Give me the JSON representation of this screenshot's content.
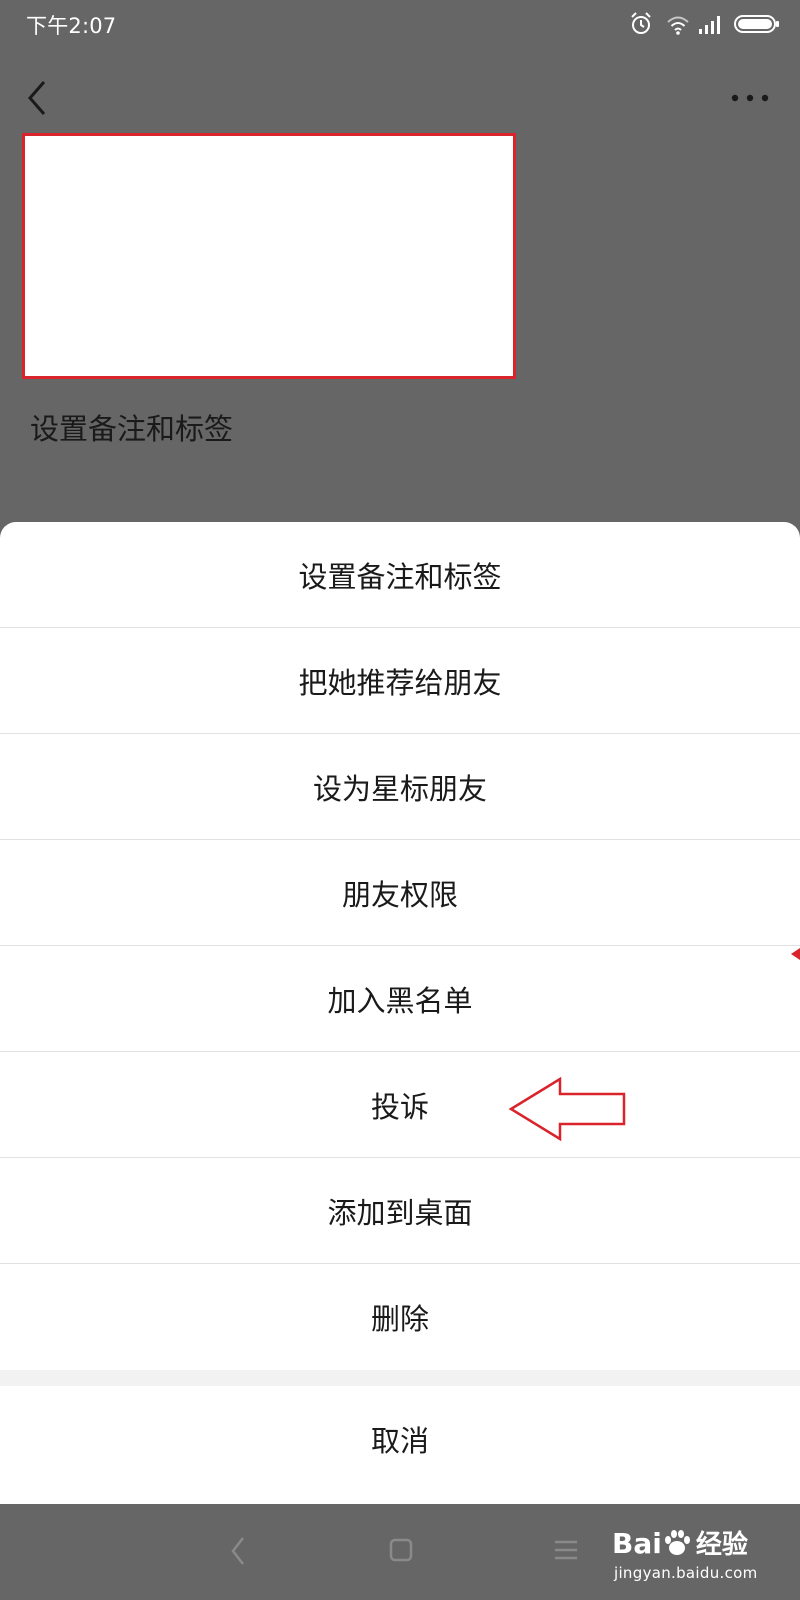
{
  "status_bar": {
    "time": "下午2:07",
    "icons": [
      "alarm-icon",
      "wifi-icon",
      "signal-icon",
      "battery-icon"
    ]
  },
  "top_bar": {
    "back_icon": "chevron-left-icon",
    "more_icon": "more-dots-icon"
  },
  "profile": {
    "remark_label": "设置备注和标签",
    "card_border_color": "#d9242b"
  },
  "action_sheet": {
    "items": [
      {
        "label": "设置备注和标签"
      },
      {
        "label": "把她推荐给朋友"
      },
      {
        "label": "设为星标朋友"
      },
      {
        "label": "朋友权限"
      },
      {
        "label": "加入黑名单"
      },
      {
        "label": "投诉"
      },
      {
        "label": "添加到桌面"
      },
      {
        "label": "删除"
      }
    ],
    "cancel_label": "取消",
    "annotation": {
      "icon": "arrow-left-outline-icon",
      "points_to": "投诉",
      "color": "#d9242b"
    }
  },
  "nav_bar": {
    "icons": [
      "nav-back-icon",
      "nav-home-icon",
      "nav-recent-icon"
    ]
  },
  "watermark": {
    "brand": "Bai",
    "brand_suffix": "经验",
    "url": "jingyan.baidu.com"
  }
}
